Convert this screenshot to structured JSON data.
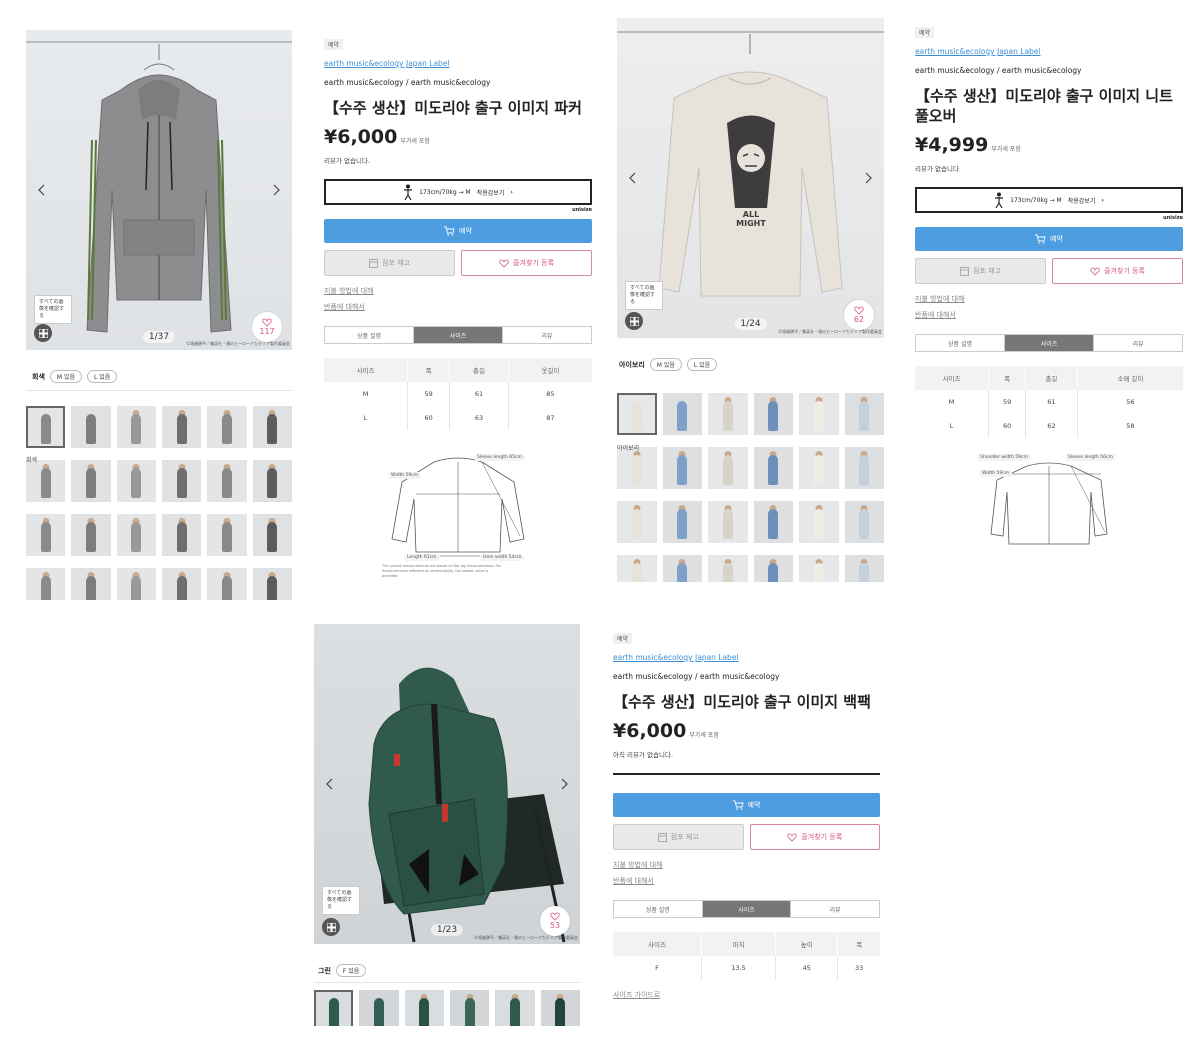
{
  "products": [
    {
      "gallery": {
        "counter": "1/37",
        "fav_count": "117",
        "tooltip": "すべての画像を確認する",
        "copyright": "©堀越耕平／集英社・僕のヒーローアカデミア製作委員会"
      },
      "color": {
        "name": "회색",
        "options": [
          "M 있음",
          "L 있음"
        ]
      },
      "thumb_caption": "회색",
      "info": {
        "tag": "예약",
        "brand_link": "earth music&ecology Japan Label",
        "brand_sub": "earth music&ecology / earth music&ecology",
        "title": "【수주 생산】미도리야 출구 이미지 파커",
        "price": "¥6,000",
        "tax": "부가세 포함",
        "reviews": "리뷰가 없습니다.",
        "fit": {
          "text": "173cm/70kg → M",
          "action": "착용감보기",
          "badge": "unisize"
        },
        "buy_label": "예약",
        "cart_label": "점포 재고",
        "fav_label": "즐겨찾기 등록",
        "links": [
          "지불 방법에 대해",
          "반품에 대해서"
        ],
        "tabs": [
          "상품 설명",
          "사이즈",
          "리뷰"
        ],
        "table": {
          "headers": [
            "사이즈",
            "폭",
            "총길",
            "옷길이"
          ],
          "rows": [
            [
              "M",
              "59",
              "61",
              "85"
            ],
            [
              "L",
              "60",
              "63",
              "87"
            ]
          ]
        },
        "diagram": {
          "labels": [
            "Sleeve length 85cm",
            "Width 59cm",
            "Length 61cm",
            "Hem width 54cm"
          ],
          "note": "The overall measurements are based on flat lay measurements. For measurements affected by stretchability, the lowest value is provided."
        }
      }
    },
    {
      "gallery": {
        "counter": "1/24",
        "fav_count": "62",
        "tooltip": "すべての画像を確認する",
        "copyright": "©堀越耕平／集英社・僕のヒーローアカデミア製作委員会",
        "print_text": "ALL MIGHT"
      },
      "color": {
        "name": "아이보리",
        "options": [
          "M 있음",
          "L 있음"
        ]
      },
      "thumb_caption": "아이보리",
      "info": {
        "tag": "예약",
        "brand_link": "earth music&ecology Japan Label",
        "brand_sub": "earth music&ecology / earth music&ecology",
        "title": "【수주 생산】미도리야 출구 이미지 니트 풀오버",
        "price": "¥4,999",
        "tax": "부가세 포함",
        "reviews": "리뷰가 없습니다.",
        "fit": {
          "text": "173cm/70kg → M",
          "action": "착용감보기",
          "badge": "unisize"
        },
        "buy_label": "예약",
        "cart_label": "점포 재고",
        "fav_label": "즐겨찾기 등록",
        "links": [
          "지불 방법에 대해",
          "반품에 대해서"
        ],
        "tabs": [
          "상품 설명",
          "사이즈",
          "리뷰"
        ],
        "table": {
          "headers": [
            "사이즈",
            "폭",
            "총길",
            "소매 길이"
          ],
          "rows": [
            [
              "M",
              "59",
              "61",
              "56"
            ],
            [
              "L",
              "60",
              "62",
              "58"
            ]
          ]
        },
        "diagram": {
          "labels": [
            "Shoulder width 59cm",
            "Sleeve length 56cm",
            "Width 59cm"
          ]
        }
      }
    },
    {
      "gallery": {
        "counter": "1/23",
        "fav_count": "53",
        "tooltip": "すべての画像を確認する",
        "copyright": "©堀越耕平／集英社・僕のヒーローアカデミア製作委員会"
      },
      "color": {
        "name": "그린",
        "options": [
          "F 있음"
        ]
      },
      "info": {
        "tag": "예약",
        "brand_link": "earth music&ecology Japan Label",
        "brand_sub": "earth music&ecology / earth music&ecology",
        "title": "【수주 생산】미도리야 출구 이미지 백팩",
        "price": "¥6,000",
        "tax": "부가세 포함",
        "reviews": "아직 리뷰가 없습니다.",
        "buy_label": "예약",
        "cart_label": "점포 재고",
        "fav_label": "즐겨찾기 등록",
        "links": [
          "지불 방법에 대해",
          "반품에 대해서"
        ],
        "tabs": [
          "상품 설명",
          "사이즈",
          "리뷰"
        ],
        "table": {
          "headers": [
            "사이즈",
            "마치",
            "높이",
            "폭"
          ],
          "rows": [
            [
              "F",
              "13.5",
              "45",
              "33"
            ]
          ]
        },
        "size_guide": "사이즈 가이드로"
      }
    }
  ],
  "colors": {
    "accent": "#4d9de0",
    "fav": "#d65a78",
    "hoodie": "#8a8a8a",
    "sweater": "#e6e3dc",
    "backpack": "#2f5a4c"
  },
  "icons": [
    "chevron-left-icon",
    "chevron-right-icon",
    "grid-icon",
    "heart-icon",
    "cart-icon",
    "store-icon",
    "person-icon"
  ]
}
